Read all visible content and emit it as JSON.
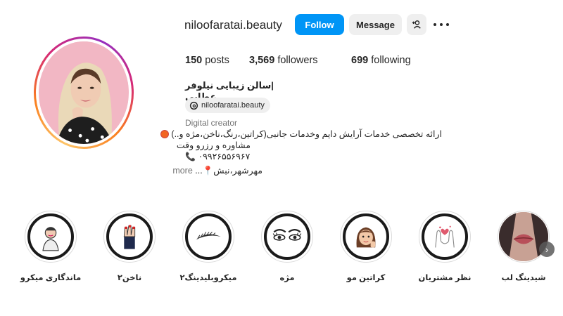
{
  "profile": {
    "username": "niloofaratai.beauty",
    "follow_label": "Follow",
    "message_label": "Message",
    "posts_count": "150",
    "posts_label": "posts",
    "followers_count": "3,569",
    "followers_label": "followers",
    "following_count": "699",
    "following_label": "following"
  },
  "bio": {
    "name": "|سالن زیبایی نیلوفر عطایی",
    "threads_handle": "niloofaratai.beauty",
    "category": "Digital creator",
    "line1": "ارائه تخصصی خدمات آرایش دایم وخدمات جانبی(کراتین،رنگ،ناخن،مژه و..)",
    "line2": "مشاوره و رزرو وقت",
    "line3": "۰۹۹۲۶۵۵۶۹۶۷",
    "line4": "مهرشهر،نبش",
    "ellipsis": "...",
    "more_label": "more"
  },
  "highlights": [
    {
      "label": "ماندگاری میکرو",
      "icon": "lip-cup-icon"
    },
    {
      "label": "ناخن۲",
      "icon": "nail-hand-icon"
    },
    {
      "label": "میکروبلیدینگ۲",
      "icon": "eyebrow-icon"
    },
    {
      "label": "مژه",
      "icon": "eyelash-icon"
    },
    {
      "label": "کراتین مو",
      "icon": "hair-girl-icon"
    },
    {
      "label": "نظر مشتریان",
      "icon": "hands-heart-icon"
    },
    {
      "label": "شیدینگ لب",
      "icon": "lips-photo"
    }
  ],
  "colors": {
    "accent": "#0095f6",
    "button_gray": "#efefef",
    "text": "#262626",
    "muted": "#737373"
  }
}
